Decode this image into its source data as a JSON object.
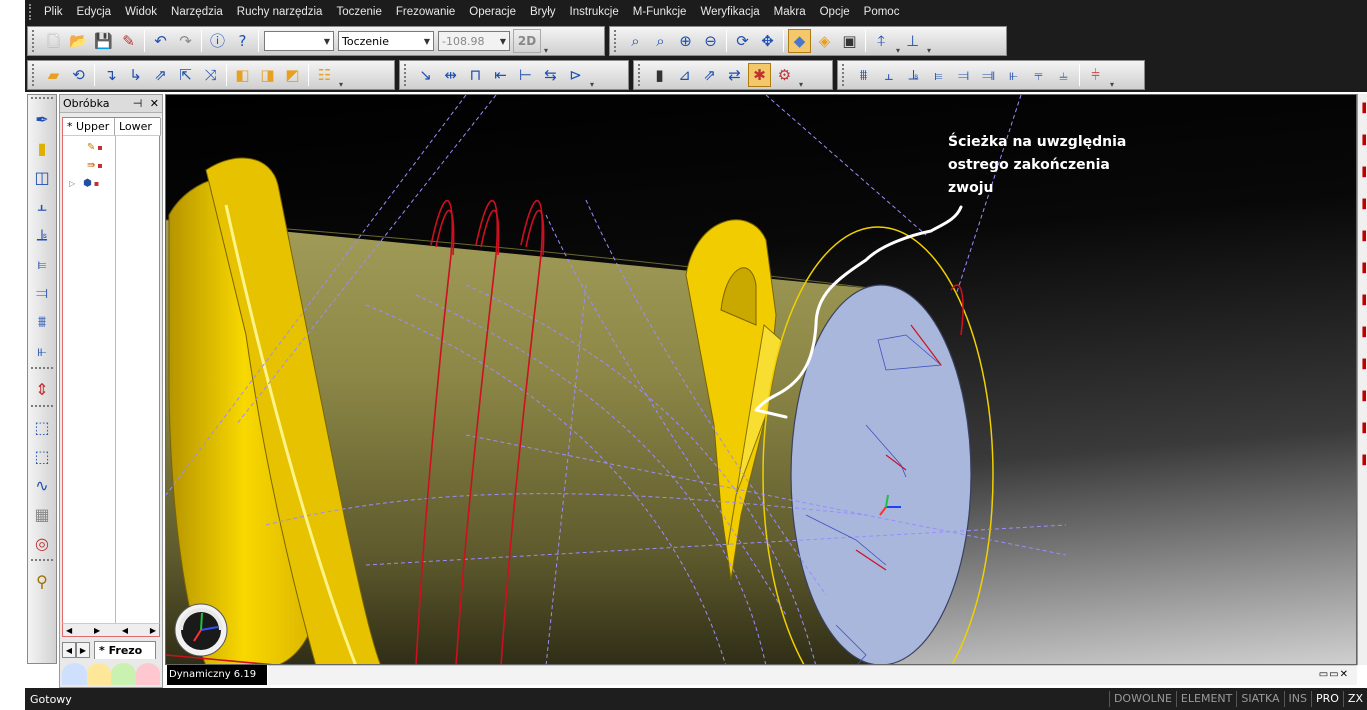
{
  "menu": [
    "Plik",
    "Edycja",
    "Widok",
    "Narzędzia",
    "Ruchy narzędzia",
    "Toczenie",
    "Frezowanie",
    "Operacje",
    "Bryły",
    "Instrukcje",
    "M-Funkcje",
    "Weryfikacja",
    "Makra",
    "Opcje",
    "Pomoc"
  ],
  "toolbar": {
    "combo_blank": "",
    "combo_mode": "Toczenie",
    "combo_value": "-108.98",
    "view_2d_label": "2D"
  },
  "panel": {
    "title": "Obróbka",
    "pin_glyph": "⊣",
    "close_glyph": "✕",
    "col_upper": "* Upper",
    "col_lower": "Lower",
    "tab_label": "* Frezo"
  },
  "viewport": {
    "annotation_line1": "Ścieżka na uwzględnia",
    "annotation_line2": "ostrego zakończenia",
    "annotation_line3": "zwoju",
    "view_status": "Dynamiczny 6.19"
  },
  "statusbar": {
    "text": "Gotowy",
    "modes": [
      {
        "label": "DOWOLNE",
        "on": false
      },
      {
        "label": "ELEMENT",
        "on": false
      },
      {
        "label": "SIATKA",
        "on": false
      },
      {
        "label": "INS",
        "on": false
      },
      {
        "label": "PRO",
        "on": true
      },
      {
        "label": "ZX",
        "on": true
      }
    ]
  },
  "colors": {
    "part_yellow": "#f5d400",
    "cylinder_olive": "#8f8a48",
    "face_blue": "#a9b7dc",
    "toolpath_red": "#cc1020",
    "toolpath_violet": "#9a8cff",
    "annotation_white": "#ffffff"
  }
}
